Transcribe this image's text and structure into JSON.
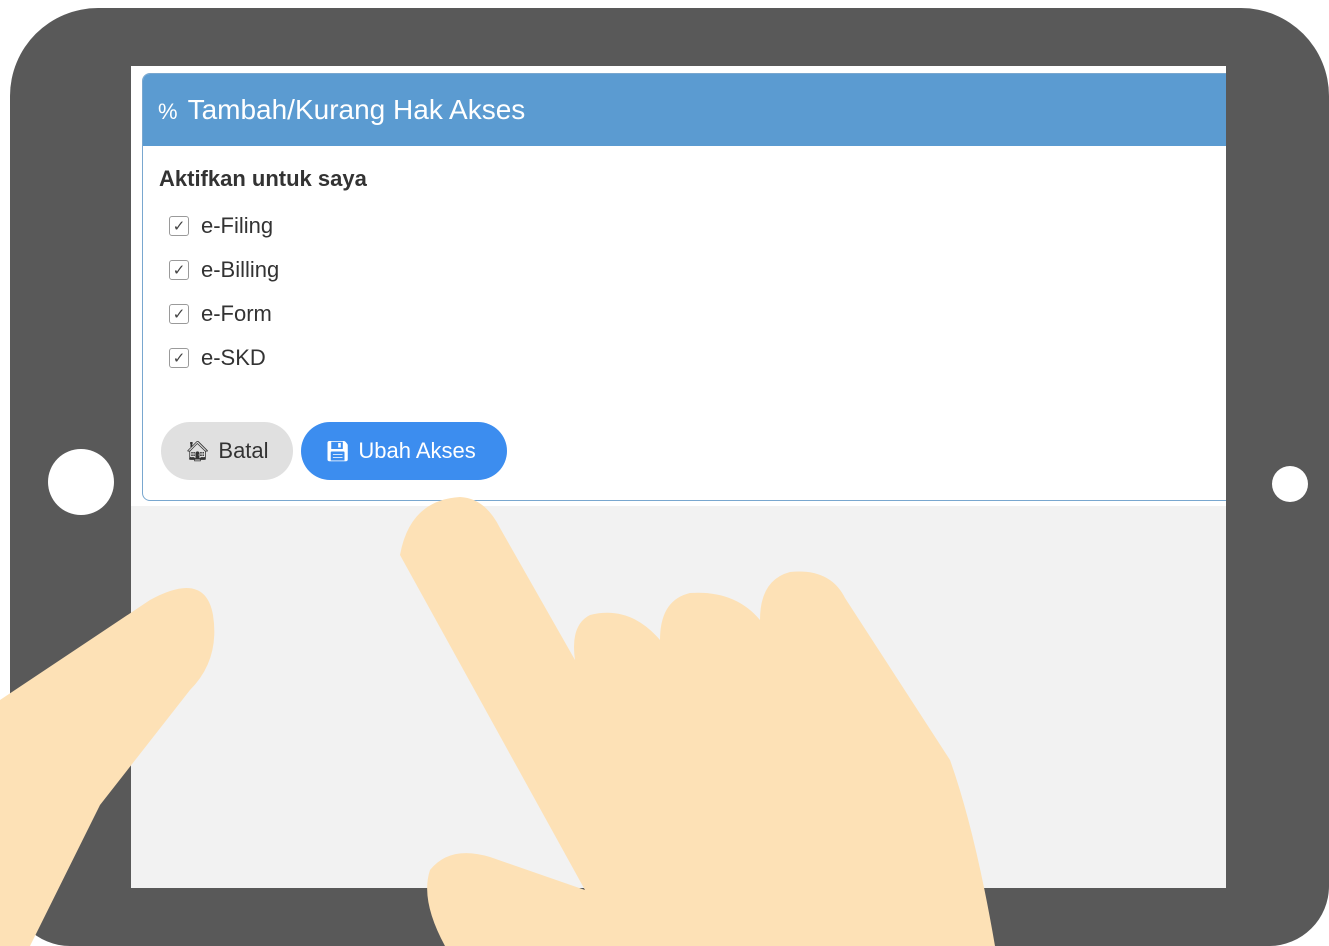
{
  "panel": {
    "title": "Tambah/Kurang Hak Akses",
    "title_icon": "link-icon"
  },
  "section": {
    "title": "Aktifkan untuk saya"
  },
  "options": [
    {
      "label": "e-Filing",
      "checked": true
    },
    {
      "label": "e-Billing",
      "checked": true
    },
    {
      "label": "e-Form",
      "checked": true
    },
    {
      "label": "e-SKD",
      "checked": true
    }
  ],
  "buttons": {
    "cancel_label": "Batal",
    "cancel_icon": "home-icon",
    "save_label": "Ubah Akses",
    "save_icon": "save-icon"
  },
  "colors": {
    "header": "#5b9bd1",
    "primary_button": "#3c8def",
    "cancel_button": "#e0e0e0",
    "tablet_frame": "#595959",
    "hand": "#fde1b6"
  }
}
